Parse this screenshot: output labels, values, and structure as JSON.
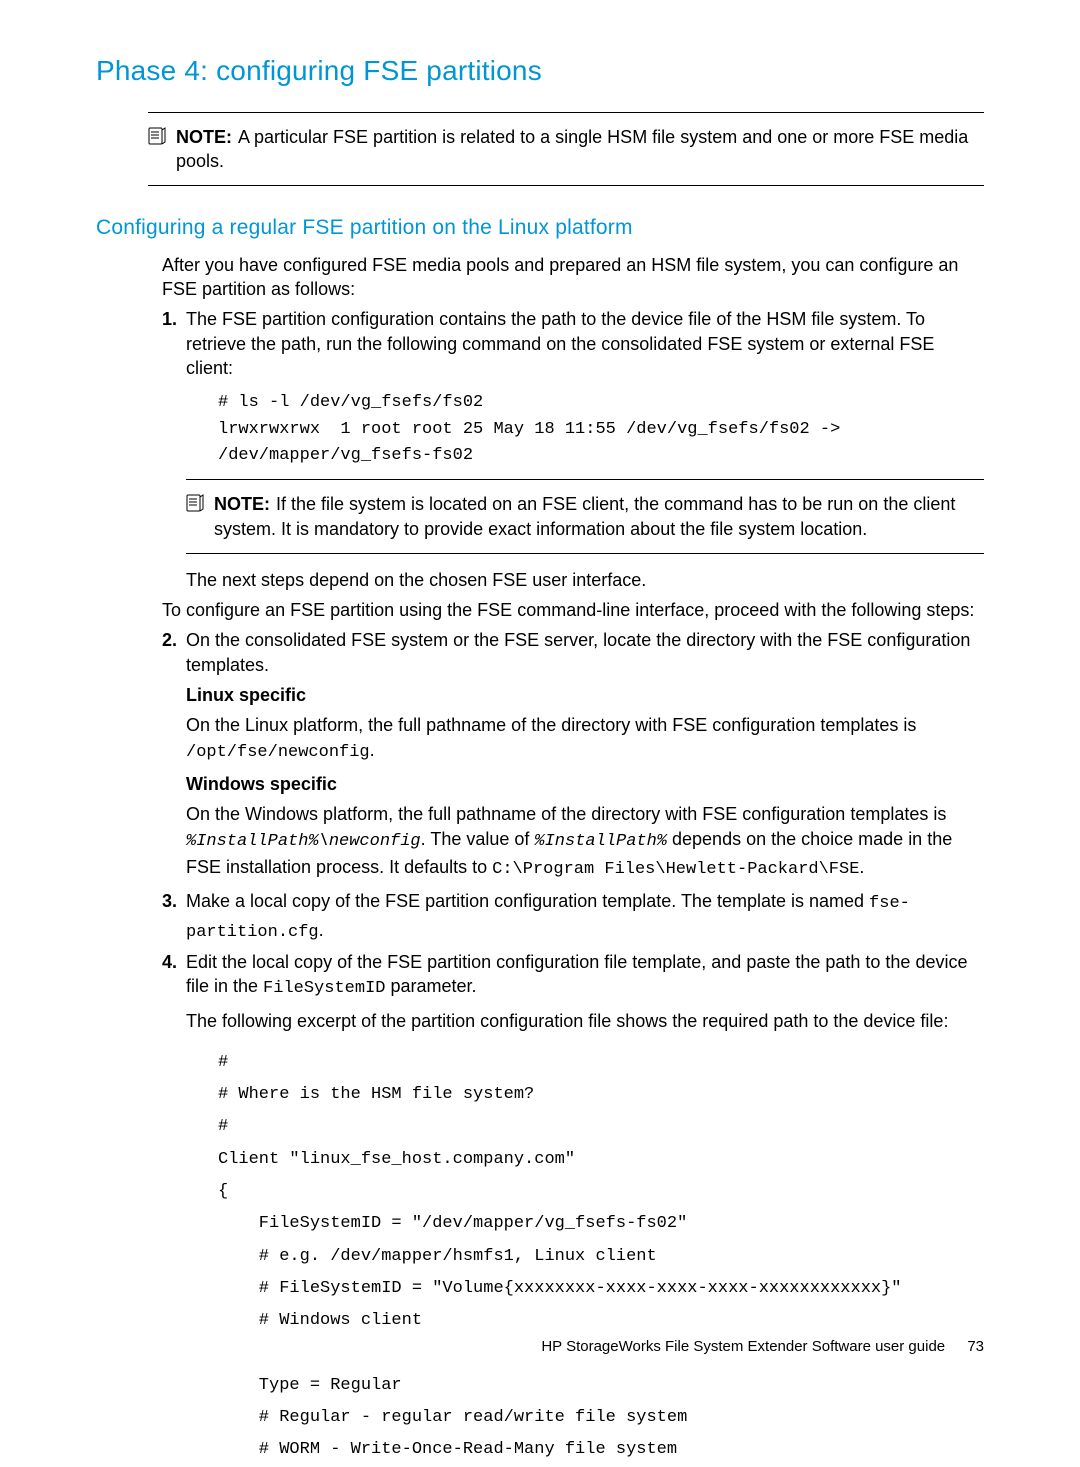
{
  "heading1": "Phase 4: configuring FSE partitions",
  "note1": {
    "label": "NOTE:",
    "text": "A particular FSE partition is related to a single HSM file system and one or more FSE media pools."
  },
  "heading2": "Configuring a regular FSE partition on the Linux platform",
  "intro": "After you have configured FSE media pools and prepared an HSM file system, you can configure an FSE partition as follows:",
  "step1": {
    "num": "1.",
    "text": "The FSE partition configuration contains the path to the device file of the HSM file system. To retrieve the path, run the following command on the consolidated FSE system or external FSE client:",
    "code": "# ls -l /dev/vg_fsefs/fs02\nlrwxrwxrwx  1 root root 25 May 18 11:55 /dev/vg_fsefs/fs02 ->\n/dev/mapper/vg_fsefs-fs02"
  },
  "note2": {
    "label": "NOTE:",
    "text": "If the file system is located on an FSE client, the command has to be run on the client system. It is mandatory to provide exact information about the file system location."
  },
  "afterNote": "The next steps depend on the chosen FSE user interface.",
  "cliIntro": "To configure an FSE partition using the FSE command-line interface, proceed with the following steps:",
  "step2": {
    "num": "2.",
    "text": "On the consolidated FSE system or the FSE server, locate the directory with the FSE configuration templates.",
    "linuxHead": "Linux specific",
    "linuxBody1": "On the Linux platform, the full pathname of the directory with FSE configuration templates is ",
    "linuxCode": "/opt/fse/newconfig",
    "linuxBody2": ".",
    "winHead": "Windows specific",
    "winBody1": "On the Windows platform, the full pathname of the directory with FSE configuration templates is ",
    "winCode1": "%InstallPath%\\newconfig",
    "winBody2": ". The value of ",
    "winCode2": "%InstallPath%",
    "winBody3": " depends on the choice made in the FSE installation process. It defaults to ",
    "winCode3": "C:\\Program Files\\Hewlett-Packard\\FSE",
    "winBody4": "."
  },
  "step3": {
    "num": "3.",
    "text1": "Make a local copy of the FSE partition configuration template. The template is named ",
    "code": "fse-partition.cfg",
    "text2": "."
  },
  "step4": {
    "num": "4.",
    "text1": "Edit the local copy of the FSE partition configuration file template, and paste the path to the device file in the ",
    "code": "FileSystemID",
    "text2": " parameter.",
    "excerptIntro": "The following excerpt of the partition configuration file shows the required path to the device file:",
    "codeBlock": "#\n# Where is the HSM file system?\n#\nClient \"linux_fse_host.company.com\"\n{\n    FileSystemID = \"/dev/mapper/vg_fsefs-fs02\"\n    # e.g. /dev/mapper/hsmfs1, Linux client\n    # FileSystemID = \"Volume{xxxxxxxx-xxxx-xxxx-xxxx-xxxxxxxxxxxx}\"\n    # Windows client\n\n    Type = Regular\n    # Regular - regular read/write file system\n    # WORM - Write-Once-Read-Many file system"
  },
  "footer": {
    "title": "HP StorageWorks File System Extender Software user guide",
    "page": "73"
  }
}
